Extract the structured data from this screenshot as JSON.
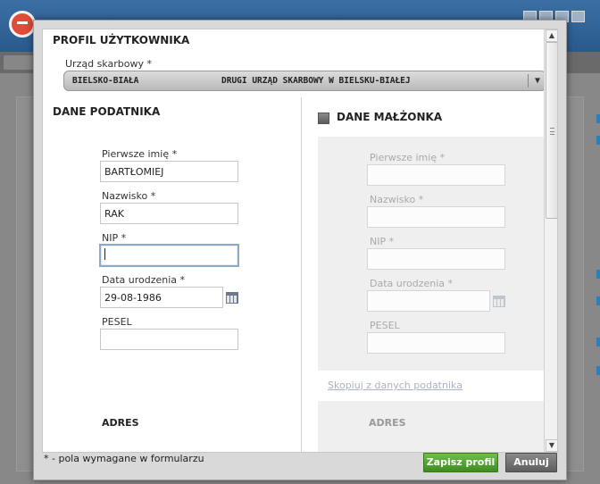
{
  "dialog": {
    "title": "PROFIL UŻYTKOWNIKA",
    "tax_office": {
      "label": "Urząd skarbowy *",
      "city": "BIELSKO-BIAŁA",
      "office": "DRUGI URZĄD SKARBOWY W BIELSKU-BIAŁEJ"
    },
    "taxpayer": {
      "section_title": "DANE PODATNIKA",
      "first_name": {
        "label": "Pierwsze imię *",
        "value": "BARTŁOMIEJ"
      },
      "last_name": {
        "label": "Nazwisko *",
        "value": "RAK"
      },
      "nip": {
        "label": "NIP *",
        "value": ""
      },
      "birth_date": {
        "label": "Data urodzenia *",
        "value": "29-08-1986"
      },
      "pesel": {
        "label": "PESEL",
        "value": ""
      },
      "address_title": "ADRES"
    },
    "spouse": {
      "section_title": "DANE MAŁŻONKA",
      "first_name": {
        "label": "Pierwsze imię *",
        "value": ""
      },
      "last_name": {
        "label": "Nazwisko *",
        "value": ""
      },
      "nip": {
        "label": "NIP *",
        "value": ""
      },
      "birth_date": {
        "label": "Data urodzenia *",
        "value": ""
      },
      "pesel": {
        "label": "PESEL",
        "value": ""
      },
      "copy_link": "Skopiuj z danych podatnika",
      "address_title": "ADRES"
    },
    "footer": {
      "required_note": "* - pola wymagane w formularzu",
      "save_label": "Zapisz profil",
      "cancel_label": "Anuluj"
    },
    "scrollbar": {
      "up_icon": "arrow-up-icon",
      "down_icon": "arrow-down-icon"
    }
  },
  "colors": {
    "save_button": "#4fa52e",
    "cancel_button": "#6e6e6e",
    "focus_border": "#8ea9c5"
  }
}
